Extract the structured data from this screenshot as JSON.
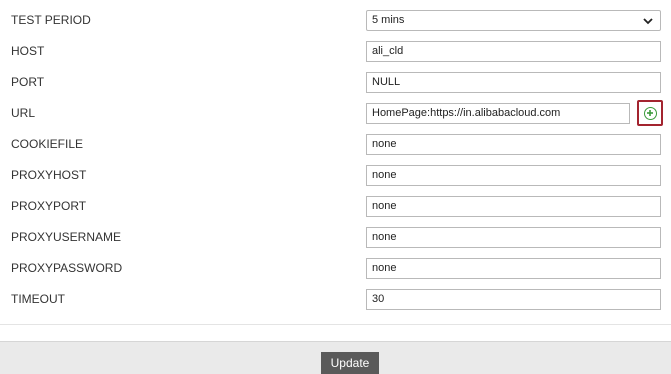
{
  "form": {
    "test_period": {
      "label": "TEST PERIOD",
      "value": "5 mins"
    },
    "host": {
      "label": "HOST",
      "value": "ali_cld"
    },
    "port": {
      "label": "PORT",
      "value": "NULL"
    },
    "url": {
      "label": "URL",
      "value": "HomePage:https://in.alibabacloud.com",
      "add_icon": "add-circle-icon"
    },
    "cookiefile": {
      "label": "COOKIEFILE",
      "value": "none"
    },
    "proxyhost": {
      "label": "PROXYHOST",
      "value": "none"
    },
    "proxyport": {
      "label": "PROXYPORT",
      "value": "none"
    },
    "proxyusername": {
      "label": "PROXYUSERNAME",
      "value": "none"
    },
    "proxypassword": {
      "label": "PROXYPASSWORD",
      "value": "none"
    },
    "timeout": {
      "label": "TIMEOUT",
      "value": "30"
    }
  },
  "footer": {
    "update_label": "Update"
  },
  "colors": {
    "highlight_border": "#a3242f",
    "add_icon": "#3a9a3a",
    "button_bg": "#5a5a5a"
  }
}
